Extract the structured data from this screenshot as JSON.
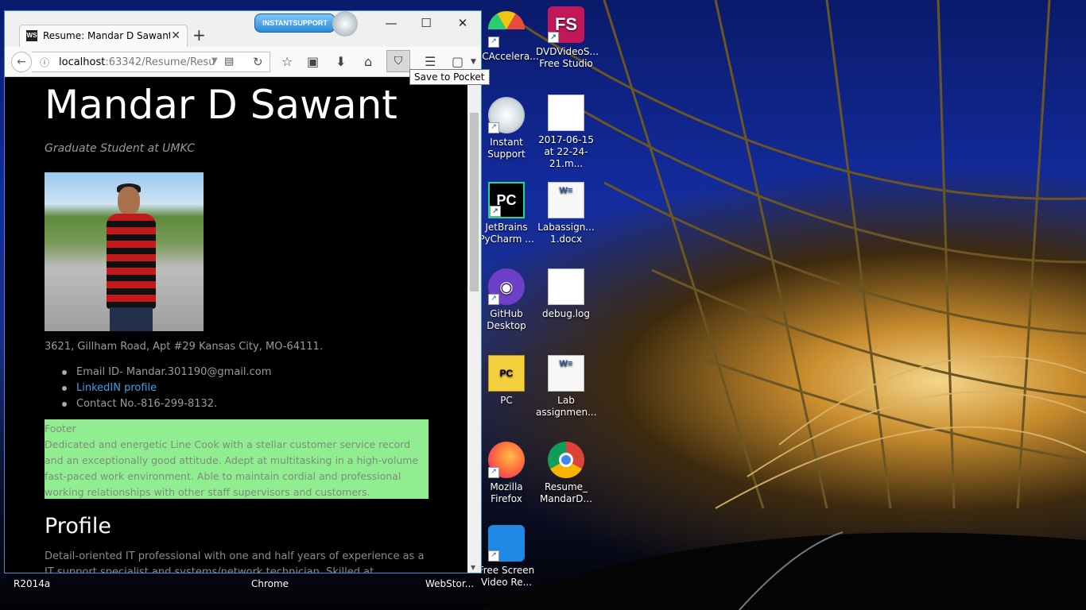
{
  "desktop": {
    "icons": [
      {
        "name": "PCAccelerate",
        "label": "PCAccelera..."
      },
      {
        "name": "DVDVideoSoft",
        "label": "DVDVideoS... Free Studio",
        "glyph": "FS"
      },
      {
        "name": "Instant Support",
        "label": "Instant Support"
      },
      {
        "name": "video file",
        "label": "2017-06-15 at 22-24-21.m..."
      },
      {
        "name": "JetBrains PyCharm",
        "label": "JetBrains PyCharm ...",
        "glyph": "PC"
      },
      {
        "name": "Labassign docx",
        "label": "Labassign... 1.docx"
      },
      {
        "name": "GitHub Desktop",
        "label": "GitHub Desktop"
      },
      {
        "name": "debug.log",
        "label": "debug.log"
      },
      {
        "name": "PC folder",
        "label": "PC",
        "glyph": "PC"
      },
      {
        "name": "Lab assignment",
        "label": "Lab assignmen..."
      },
      {
        "name": "Mozilla Firefox",
        "label": "Mozilla Firefox"
      },
      {
        "name": "Resume Chrome",
        "label": "Resume_ MandarD..."
      },
      {
        "name": "Free Screen Video Recorder",
        "label": "Free Screen Video Re..."
      }
    ],
    "behind_labels": [
      "R2014a",
      "Chrome",
      "WebStor..."
    ]
  },
  "browser": {
    "tab_title": "Resume: Mandar D Sawant,",
    "favicon_text": "WS",
    "new_tab": "+",
    "instant_badge": "INSTANTSUPPORT",
    "controls": {
      "minimize": "—",
      "maximize": "☐",
      "close": "✕"
    },
    "url_host": "localhost",
    "url_rest": ":63342/Resume/Resu",
    "tooltip": "Save to Pocket"
  },
  "page": {
    "name": "Mandar D Sawant",
    "subtitle": "Graduate Student at UMKC",
    "address": "3621, Gillham Road, Apt #29 Kansas City, MO-64111.",
    "contacts": {
      "email": "Email ID- Mandar.301190@gmail.com",
      "linkedin": "LinkedIN profile",
      "phone": "Contact No.-816-299-8132."
    },
    "footer": {
      "title": "Footer",
      "text": "Dedicated and energetic Line Cook with a stellar customer service record and an exceptionally good attitude. Adept at multitasking in a high-volume fast-paced work environment. Able to maintain cordial and professional working relationships with other staff supervisors and customers."
    },
    "profile_heading": "Profile",
    "profile_text": "Detail-oriented IT professional with one and half years of experience as a IT support specialist and systems/network technician. Skilled at operating in a wide"
  },
  "colors": {
    "footer_bg": "#90ee90",
    "link": "#3ea0e8",
    "page_bg": "#000000",
    "window_border": "#3a8fd8"
  }
}
